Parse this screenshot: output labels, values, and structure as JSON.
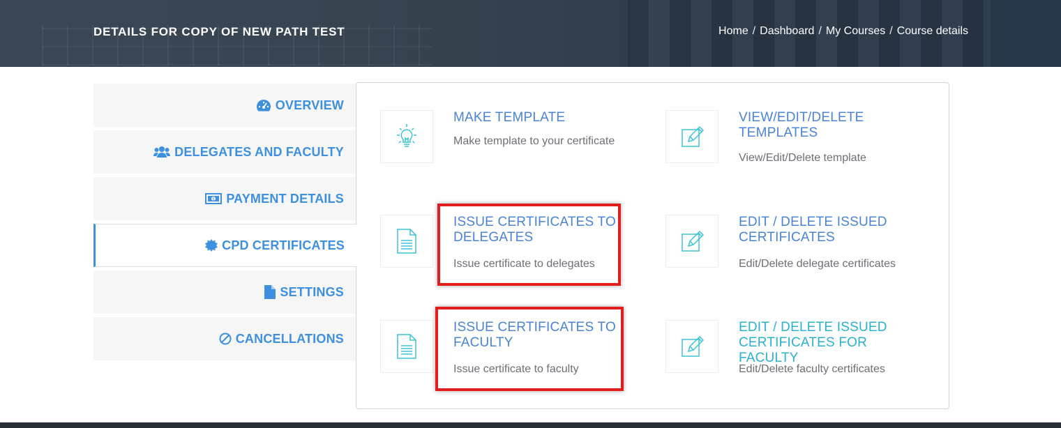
{
  "header": {
    "title": "DETAILS FOR COPY OF NEW PATH TEST",
    "breadcrumb": [
      "Home",
      "Dashboard",
      "My Courses",
      "Course details"
    ],
    "separator": "/"
  },
  "tabs": [
    {
      "label": "OVERVIEW",
      "icon": "tachometer-icon",
      "active": false
    },
    {
      "label": "DELEGATES AND FACULTY",
      "icon": "users-icon",
      "active": false
    },
    {
      "label": "PAYMENT DETAILS",
      "icon": "money-icon",
      "active": false
    },
    {
      "label": "CPD CERTIFICATES",
      "icon": "certificate-icon",
      "active": true
    },
    {
      "label": "SETTINGS",
      "icon": "file-icon",
      "active": false
    },
    {
      "label": "CANCELLATIONS",
      "icon": "ban-icon",
      "active": false
    }
  ],
  "cards": {
    "make_template": {
      "title": "MAKE TEMPLATE",
      "desc": "Make template to your certificate",
      "icon": "lightbulb-icon"
    },
    "view_templates": {
      "title": "VIEW/EDIT/DELETE TEMPLATES",
      "desc": "View/Edit/Delete template",
      "icon": "edit-icon"
    },
    "issue_delegates": {
      "title": "ISSUE CERTIFICATES TO DELEGATES",
      "desc": "Issue certificate to delegates",
      "icon": "document-icon"
    },
    "edit_delegates": {
      "title": "EDIT / DELETE ISSUED CERTIFICATES",
      "desc": "Edit/Delete delegate certificates",
      "icon": "edit-icon"
    },
    "issue_faculty": {
      "title": "ISSUE CERTIFICATES TO FACULTY",
      "desc": "Issue certificate to faculty",
      "icon": "document-icon"
    },
    "edit_faculty": {
      "title": "EDIT / DELETE ISSUED CERTIFICATES FOR FACULTY",
      "desc": "Edit/Delete faculty certificates",
      "icon": "edit-icon"
    }
  },
  "colors": {
    "accent": "#3d8fe0",
    "card_title": "#4a83d6",
    "card_title_hover": "#2ab1cf",
    "icon": "#3bc3d6",
    "highlight": "#e21d1d"
  }
}
